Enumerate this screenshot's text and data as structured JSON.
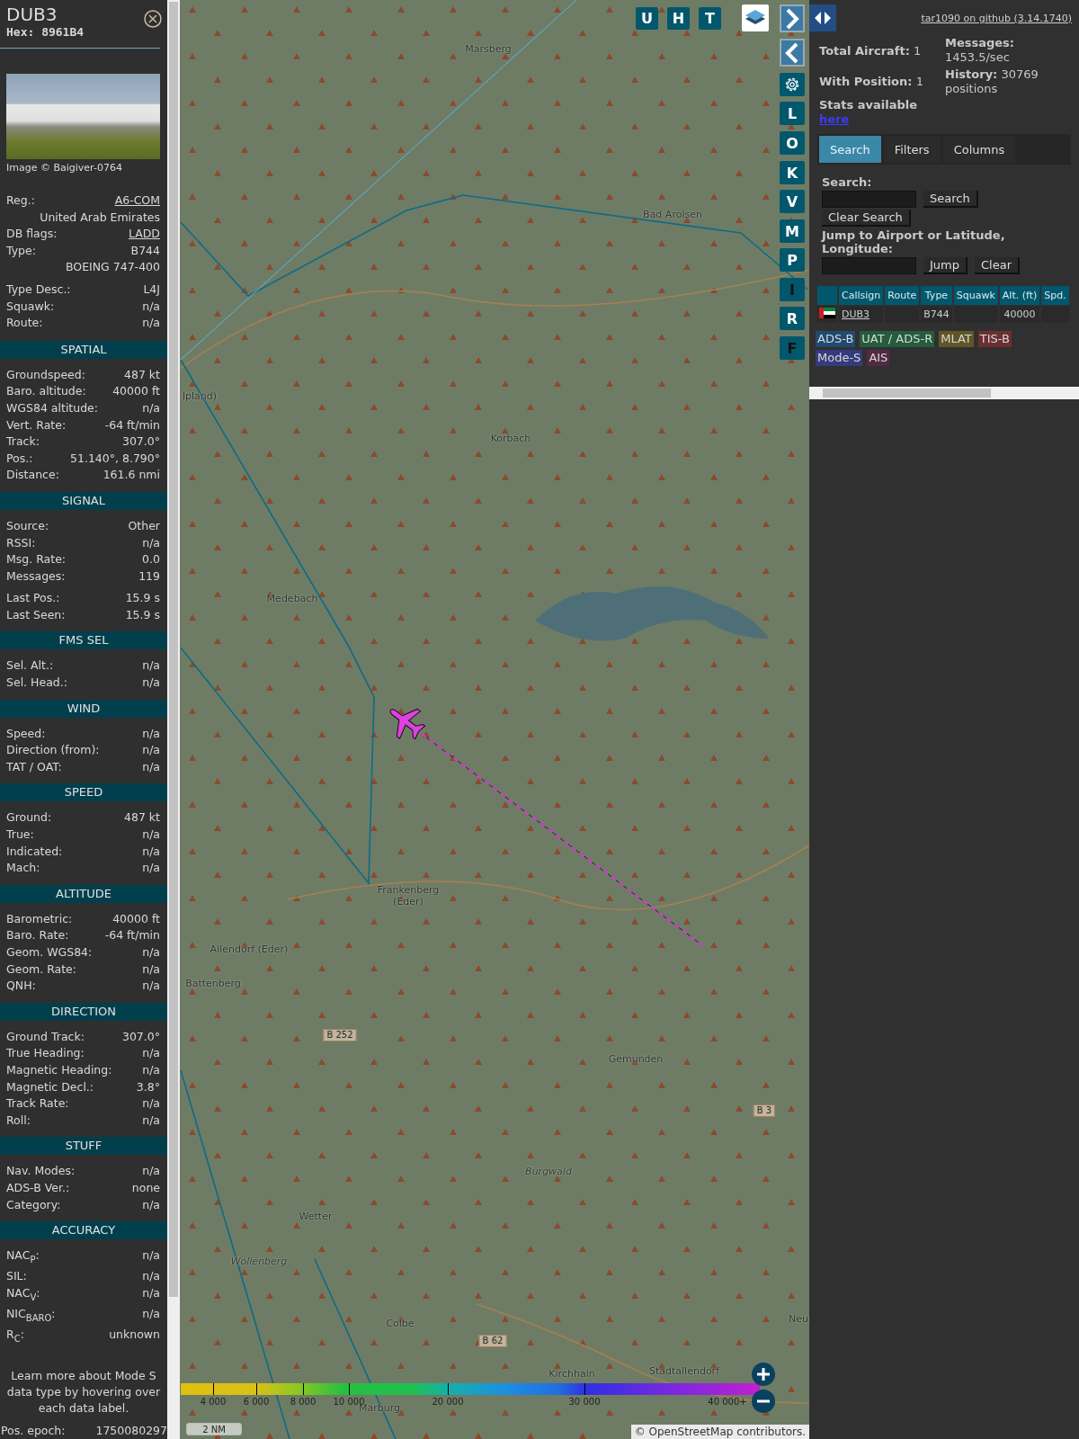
{
  "detail_panel": {
    "callsign": "DUB3",
    "hex": "Hex: 8961B4",
    "image_credit": "Image © Baigiver-0764",
    "groups": [
      [
        {
          "kind": "link",
          "label": "Reg.:",
          "value": "A6-COM"
        },
        {
          "kind": "extra",
          "value": "United Arab Emirates"
        },
        {
          "kind": "link",
          "label": "DB flags:",
          "value": "LADD"
        },
        {
          "kind": "field",
          "label": "Type:",
          "value": "B744"
        },
        {
          "kind": "extra",
          "value": "BOEING 747-400"
        }
      ],
      [
        {
          "kind": "field",
          "label": "Type Desc.:",
          "value": "L4J"
        },
        {
          "kind": "field",
          "label": "Squawk:",
          "value": "n/a"
        },
        {
          "kind": "field",
          "label": "Route:",
          "value": "n/a"
        }
      ]
    ],
    "sections": [
      {
        "title": "SPATIAL",
        "groups": [
          [
            {
              "kind": "field",
              "label": "Groundspeed:",
              "value": "487 kt"
            },
            {
              "kind": "field",
              "label": "Baro. altitude:",
              "value": "40000 ft"
            },
            {
              "kind": "field",
              "label": "WGS84 altitude:",
              "value": "n/a"
            },
            {
              "kind": "field",
              "label": "Vert. Rate:",
              "value": "-64 ft/min"
            },
            {
              "kind": "field",
              "label": "Track:",
              "value": "307.0°"
            },
            {
              "kind": "field",
              "label": "Pos.:",
              "value": "51.140°, 8.790°"
            },
            {
              "kind": "field",
              "label": "Distance:",
              "value": "161.6 nmi"
            }
          ]
        ]
      },
      {
        "title": "SIGNAL",
        "groups": [
          [
            {
              "kind": "field",
              "label": "Source:",
              "value": "Other"
            },
            {
              "kind": "field",
              "label": "RSSI:",
              "value": "n/a"
            },
            {
              "kind": "field",
              "label": "Msg. Rate:",
              "value": "0.0"
            },
            {
              "kind": "field",
              "label": "Messages:",
              "value": "119"
            }
          ],
          [
            {
              "kind": "field",
              "label": "Last Pos.:",
              "value": "15.9 s"
            },
            {
              "kind": "field",
              "label": "Last Seen:",
              "value": "15.9 s"
            }
          ]
        ]
      },
      {
        "title": "FMS SEL",
        "groups": [
          [
            {
              "kind": "field",
              "label": "Sel. Alt.:",
              "value": "n/a"
            },
            {
              "kind": "field",
              "label": "Sel. Head.:",
              "value": "n/a"
            }
          ]
        ]
      },
      {
        "title": "WIND",
        "groups": [
          [
            {
              "kind": "field",
              "label": "Speed:",
              "value": "n/a"
            },
            {
              "kind": "field",
              "label": "Direction (from):",
              "value": "n/a"
            },
            {
              "kind": "field",
              "label": "TAT / OAT:",
              "value": "n/a"
            }
          ]
        ]
      },
      {
        "title": "SPEED",
        "groups": [
          [
            {
              "kind": "field",
              "label": "Ground:",
              "value": "487 kt"
            },
            {
              "kind": "field",
              "label": "True:",
              "value": "n/a"
            },
            {
              "kind": "field",
              "label": "Indicated:",
              "value": "n/a"
            },
            {
              "kind": "field",
              "label": "Mach:",
              "value": "n/a"
            }
          ]
        ]
      },
      {
        "title": "ALTITUDE",
        "groups": [
          [
            {
              "kind": "field",
              "label": "Barometric:",
              "value": "40000 ft"
            },
            {
              "kind": "field",
              "label": "Baro. Rate:",
              "value": "-64 ft/min"
            },
            {
              "kind": "field",
              "label": "Geom. WGS84:",
              "value": "n/a"
            },
            {
              "kind": "field",
              "label": "Geom. Rate:",
              "value": "n/a"
            },
            {
              "kind": "field",
              "label": "QNH:",
              "value": "n/a"
            }
          ]
        ]
      },
      {
        "title": "DIRECTION",
        "groups": [
          [
            {
              "kind": "field",
              "label": "Ground Track:",
              "value": "307.0°"
            },
            {
              "kind": "field",
              "label": "True Heading:",
              "value": "n/a"
            },
            {
              "kind": "field",
              "label": "Magnetic Heading:",
              "value": "n/a"
            },
            {
              "kind": "field",
              "label": "Magnetic Decl.:",
              "value": "3.8°"
            },
            {
              "kind": "field",
              "label": "Track Rate:",
              "value": "n/a"
            },
            {
              "kind": "field",
              "label": "Roll:",
              "value": "n/a"
            }
          ]
        ]
      },
      {
        "title": "STUFF",
        "groups": [
          [
            {
              "kind": "field",
              "label": "Nav. Modes:",
              "value": "n/a"
            },
            {
              "kind": "field",
              "label": "ADS-B Ver.:",
              "value": "none"
            },
            {
              "kind": "field",
              "label": "Category:",
              "value": "n/a"
            }
          ]
        ]
      },
      {
        "title": "ACCURACY",
        "groups": [
          [
            {
              "kind": "field",
              "label": "NAC$_{P}$:",
              "value": "n/a"
            },
            {
              "kind": "field",
              "label": "SIL:",
              "value": "n/a"
            },
            {
              "kind": "field",
              "label": "NAC$_{V}$:",
              "value": "n/a"
            },
            {
              "kind": "field",
              "label": "NIC$_{BARO}$:",
              "value": "n/a"
            },
            {
              "kind": "field",
              "label": "R$_{C}$:",
              "value": "unknown"
            }
          ]
        ]
      }
    ],
    "note": "Learn more about Mode S data type by hovering over each data label.",
    "footer": {
      "label": "Pos. epoch:",
      "value": "1750080297"
    }
  },
  "map": {
    "top_buttons": [
      {
        "label": "U",
        "on": true
      },
      {
        "label": "H",
        "on": true
      },
      {
        "label": "T",
        "on": true
      }
    ],
    "side_button_groups": [
      [
        {
          "label": "L",
          "on": true
        },
        {
          "label": "O",
          "on": true
        },
        {
          "label": "K",
          "on": true
        }
      ],
      [
        {
          "label": "V",
          "on": true
        },
        {
          "label": "M",
          "on": true
        }
      ],
      [
        {
          "label": "P",
          "on": true
        },
        {
          "label": "I",
          "on": false
        }
      ],
      [
        {
          "label": "R",
          "on": true
        },
        {
          "label": "F",
          "on": false
        }
      ]
    ],
    "labels": [
      {
        "kind": "place",
        "text": "Marsberg"
      },
      {
        "kind": "place",
        "text": "Bad Arolsen"
      },
      {
        "kind": "place",
        "text": "lpland)"
      },
      {
        "kind": "place",
        "text": "Korbach"
      },
      {
        "kind": "place",
        "text": "Medebach"
      },
      {
        "kind": "place",
        "text": "Frankenberg\n(Eder)"
      },
      {
        "kind": "place",
        "text": "Allendorf (Eder)"
      },
      {
        "kind": "place",
        "text": "Battenberg"
      },
      {
        "kind": "road",
        "text": "B 252"
      },
      {
        "kind": "place",
        "text": "Gemunden"
      },
      {
        "kind": "road",
        "text": "B 3"
      },
      {
        "kind": "area",
        "text": "Burgwald"
      },
      {
        "kind": "place",
        "text": "Wetter"
      },
      {
        "kind": "area",
        "text": "Wollenberg"
      },
      {
        "kind": "place",
        "text": "Colbe"
      },
      {
        "kind": "road",
        "text": "B 62"
      },
      {
        "kind": "place",
        "text": "Kirchhain"
      },
      {
        "kind": "place",
        "text": "Stadtallendorf"
      },
      {
        "kind": "place",
        "text": "Marburg"
      },
      {
        "kind": "place",
        "text": "Neu"
      }
    ],
    "altitude_legend": [
      "4 000",
      "6 000",
      "8 000",
      "10 000",
      "20 000",
      "30 000",
      "40 000+"
    ],
    "scale": "2 NM",
    "attribution": "© OpenStreetMap contributors."
  },
  "sidebar": {
    "version_link": "tar1090 on github (3.14.1740)",
    "total_aircraft": "**Total Aircraft:** 1",
    "with_position": "**With Position:** 1",
    "messages": "**Messages:** 1453.5/sec",
    "history": "**History:** 30769 positions",
    "stats_text": "Stats available",
    "stats_link": "here",
    "tabs": [
      {
        "label": "Search",
        "selected": true
      },
      {
        "label": "Filters",
        "selected": false
      },
      {
        "label": "Columns",
        "selected": false
      }
    ],
    "search_label": "Search:",
    "search_button": "Search",
    "clear_search_button": "Clear Search",
    "jump_label": "Jump to Airport or Latitude, Longitude:",
    "jump_button": "Jump",
    "clear_button": "Clear",
    "table": {
      "columns": [
        "Callsign",
        "Route",
        "Type",
        "Squawk",
        "Alt. (ft)",
        "Spd."
      ],
      "rows": [
        {
          "cells": [
            "DUB3",
            "",
            "B744",
            "",
            "40000",
            ""
          ]
        }
      ]
    },
    "source_tags": [
      {
        "label": "ADS-B",
        "color": "#1f4b6e"
      },
      {
        "label": "UAT / ADS-R",
        "color": "#245c3c"
      },
      {
        "label": "MLAT",
        "color": "#5f5625"
      },
      {
        "label": "TIS-B",
        "color": "#6b2f2f"
      },
      {
        "label": "Mode-S",
        "color": "#343b7c"
      },
      {
        "label": "AIS",
        "color": "#522a45"
      }
    ]
  }
}
